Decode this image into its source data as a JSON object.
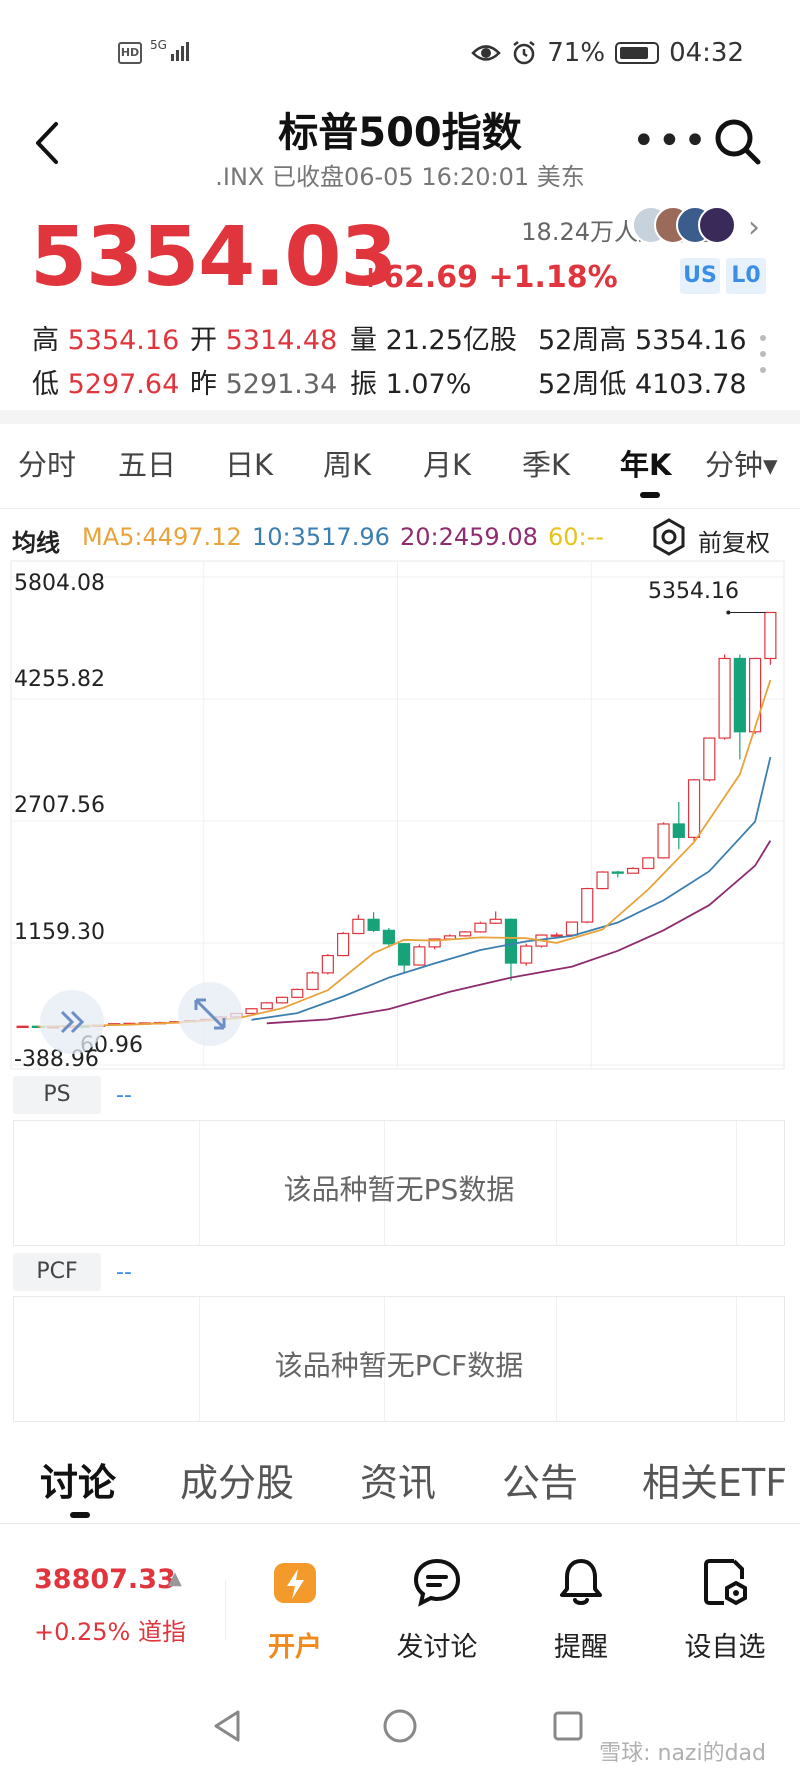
{
  "status_bar": {
    "hd": "HD",
    "network": "5G",
    "battery_pct": "71%",
    "time": "04:32"
  },
  "header": {
    "title": "标普500指数",
    "subtitle": ".INX 已收盘06-05 16:20:01 美东"
  },
  "quote": {
    "price": "5354.03",
    "change": "+62.69 +1.18%",
    "followers": "18.24万人加自选",
    "tags": [
      "US",
      "L0"
    ]
  },
  "stats": {
    "high_label": "高",
    "high": "5354.16",
    "open_label": "开",
    "open": "5314.48",
    "vol_label": "量",
    "vol": "21.25亿股",
    "w52h_label": "52周高",
    "w52h": "5354.16",
    "low_label": "低",
    "low": "5297.64",
    "prev_label": "昨",
    "prev": "5291.34",
    "amp_label": "振",
    "amp": "1.07%",
    "w52l_label": "52周低",
    "w52l": "4103.78"
  },
  "period_tabs": [
    "分时",
    "五日",
    "日K",
    "周K",
    "月K",
    "季K",
    "年K",
    "分钟▾"
  ],
  "period_active": "年K",
  "ma_legend": {
    "avg": "均线",
    "ma5": "MA5:4497.12",
    "ma10": "10:3517.96",
    "ma20": "20:2459.08",
    "ma60": "60:--",
    "adjust": "前复权"
  },
  "colors": {
    "up": "#e0353d",
    "down": "#17a37a",
    "ma5": "#e8a33a",
    "ma10": "#3a7fb0",
    "ma20": "#8e2c6e",
    "ma60": "#e8c21a"
  },
  "chart_data": {
    "type": "candlestick",
    "y_ticks": [
      "5804.08",
      "4255.82",
      "2707.56",
      "1159.30",
      "-388.96"
    ],
    "ylim": [
      -388.96,
      5804.08
    ],
    "max_label": "5354.16",
    "min_label": "60.96",
    "candles": [
      [
        100,
        103,
        95,
        108
      ],
      [
        103,
        95,
        90,
        105
      ],
      [
        95,
        98,
        90,
        102
      ],
      [
        98,
        108,
        96,
        110
      ],
      [
        108,
        102,
        100,
        112
      ],
      [
        102,
        118,
        100,
        120
      ],
      [
        118,
        135,
        116,
        138
      ],
      [
        135,
        140,
        130,
        145
      ],
      [
        140,
        145,
        135,
        150
      ],
      [
        145,
        150,
        140,
        160
      ],
      [
        150,
        160,
        145,
        170
      ],
      [
        160,
        175,
        150,
        180
      ],
      [
        175,
        190,
        170,
        200
      ],
      [
        190,
        220,
        180,
        230
      ],
      [
        220,
        265,
        215,
        270
      ],
      [
        265,
        325,
        260,
        330
      ],
      [
        325,
        400,
        320,
        410
      ],
      [
        400,
        470,
        390,
        480
      ],
      [
        470,
        570,
        460,
        580
      ],
      [
        570,
        780,
        560,
        800
      ],
      [
        780,
        1000,
        760,
        1020
      ],
      [
        1000,
        1280,
        990,
        1300
      ],
      [
        1280,
        1460,
        1270,
        1520
      ],
      [
        1460,
        1320,
        1300,
        1550
      ],
      [
        1320,
        1150,
        1100,
        1350
      ],
      [
        1150,
        880,
        780,
        1160
      ],
      [
        880,
        1110,
        870,
        1140
      ],
      [
        1110,
        1210,
        1080,
        1215
      ],
      [
        1210,
        1250,
        1200,
        1270
      ],
      [
        1250,
        1300,
        1240,
        1310
      ],
      [
        1300,
        1410,
        1290,
        1430
      ],
      [
        1410,
        1460,
        1400,
        1560
      ],
      [
        1460,
        905,
        680,
        1470
      ],
      [
        905,
        1120,
        870,
        1150
      ],
      [
        1120,
        1260,
        1100,
        1270
      ],
      [
        1260,
        1260,
        1250,
        1290
      ],
      [
        1260,
        1425,
        1250,
        1430
      ],
      [
        1425,
        1850,
        1410,
        1860
      ],
      [
        1850,
        2060,
        1840,
        2070
      ],
      [
        2060,
        2045,
        1990,
        2075
      ],
      [
        2045,
        2105,
        2040,
        2120
      ],
      [
        2105,
        2240,
        2100,
        2240
      ],
      [
        2240,
        2670,
        2230,
        2690
      ],
      [
        2670,
        2500,
        2350,
        2950
      ],
      [
        2500,
        3230,
        2450,
        3240
      ],
      [
        3230,
        3760,
        3210,
        3760
      ],
      [
        3760,
        4770,
        3740,
        4820
      ],
      [
        4770,
        3840,
        3490,
        4820
      ],
      [
        3840,
        4770,
        3810,
        4780
      ],
      [
        4770,
        5354,
        4690,
        5354
      ]
    ],
    "ma5": [
      [
        1,
        98
      ],
      [
        7,
        122
      ],
      [
        10,
        148
      ],
      [
        14,
        200
      ],
      [
        17,
        330
      ],
      [
        20,
        560
      ],
      [
        23,
        1030
      ],
      [
        25,
        1200
      ],
      [
        27,
        1190
      ],
      [
        30,
        1230
      ],
      [
        33,
        1220
      ],
      [
        35,
        1160
      ],
      [
        38,
        1330
      ],
      [
        41,
        1840
      ],
      [
        44,
        2440
      ],
      [
        47,
        3300
      ],
      [
        49,
        4497
      ]
    ],
    "ma10": [
      [
        15,
        185
      ],
      [
        18,
        270
      ],
      [
        21,
        480
      ],
      [
        24,
        720
      ],
      [
        27,
        900
      ],
      [
        30,
        1070
      ],
      [
        33,
        1180
      ],
      [
        36,
        1250
      ],
      [
        39,
        1420
      ],
      [
        42,
        1700
      ],
      [
        45,
        2070
      ],
      [
        48,
        2700
      ],
      [
        49,
        3518
      ]
    ],
    "ma20": [
      [
        16,
        140
      ],
      [
        20,
        190
      ],
      [
        24,
        320
      ],
      [
        28,
        540
      ],
      [
        32,
        720
      ],
      [
        36,
        860
      ],
      [
        39,
        1060
      ],
      [
        42,
        1320
      ],
      [
        45,
        1640
      ],
      [
        48,
        2140
      ],
      [
        49,
        2459
      ]
    ]
  },
  "sub_panels": [
    {
      "tag": "PS",
      "value": "--",
      "empty_text": "该品种暂无PS数据"
    },
    {
      "tag": "PCF",
      "value": "--",
      "empty_text": "该品种暂无PCF数据"
    }
  ],
  "bottom_tabs": [
    "讨论",
    "成分股",
    "资讯",
    "公告",
    "相关ETF"
  ],
  "bottom_active": "讨论",
  "dow": {
    "value": "38807.33",
    "change": "+0.25%",
    "name": "道指"
  },
  "actions": [
    {
      "label": "开户",
      "icon": "bolt-icon"
    },
    {
      "label": "发讨论",
      "icon": "chat-bubble-icon"
    },
    {
      "label": "提醒",
      "icon": "bell-icon"
    },
    {
      "label": "设自选",
      "icon": "watchlist-add-icon"
    }
  ],
  "watermark": "雪球: nazi的dad"
}
